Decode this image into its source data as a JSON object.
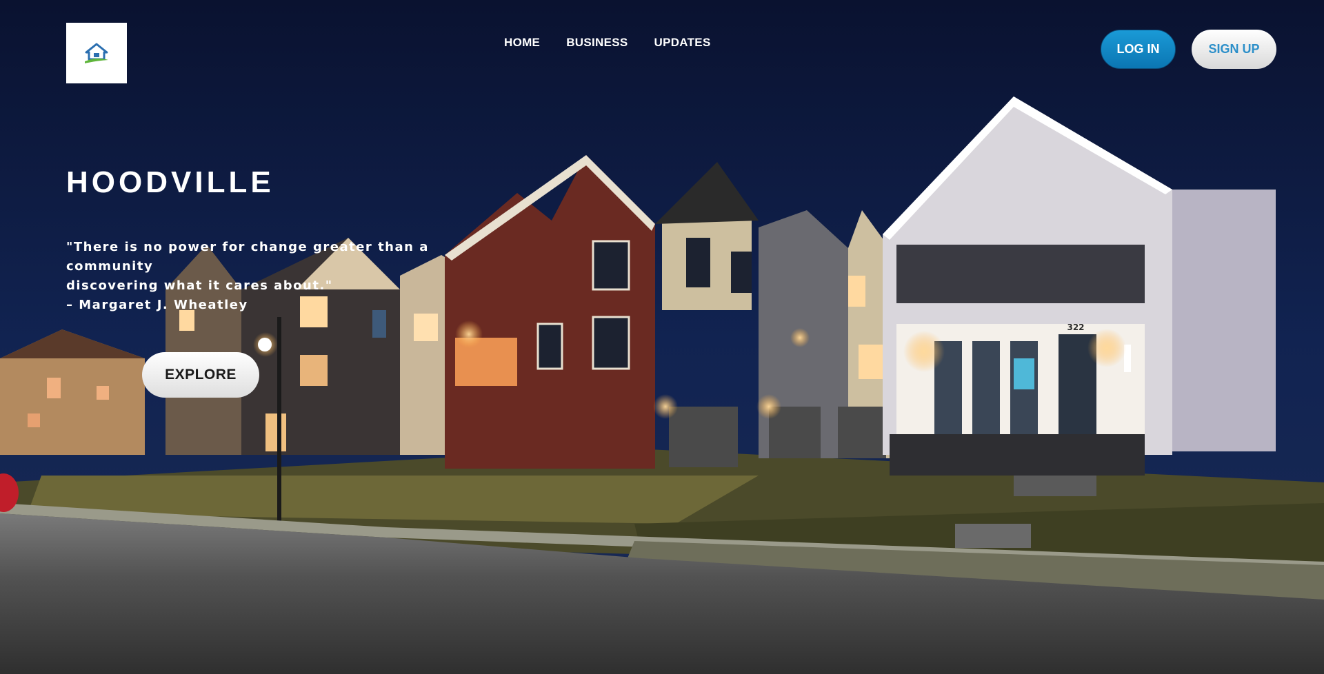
{
  "brand": {
    "logo_icon": "house-icon",
    "colors": {
      "roof": "#2b6fb0",
      "swoosh": "#5fb53b"
    }
  },
  "nav": {
    "items": [
      {
        "label": "HOME"
      },
      {
        "label": "BUSINESS"
      },
      {
        "label": "UPDATES"
      }
    ]
  },
  "auth": {
    "login_label": "LOG IN",
    "signup_label": "SIGN UP",
    "login_color": "#0b86c6",
    "signup_text_color": "#2c8fc9"
  },
  "hero": {
    "title": "HOODVILLE",
    "quote_line1": "\"There is no power for change greater than a community",
    "quote_line2": "discovering what it cares about.\"",
    "quote_author": "– Margaret J. Wheatley",
    "explore_label": "EXPLORE",
    "house_number": "322",
    "background": "night-street-townhouses-photo"
  }
}
